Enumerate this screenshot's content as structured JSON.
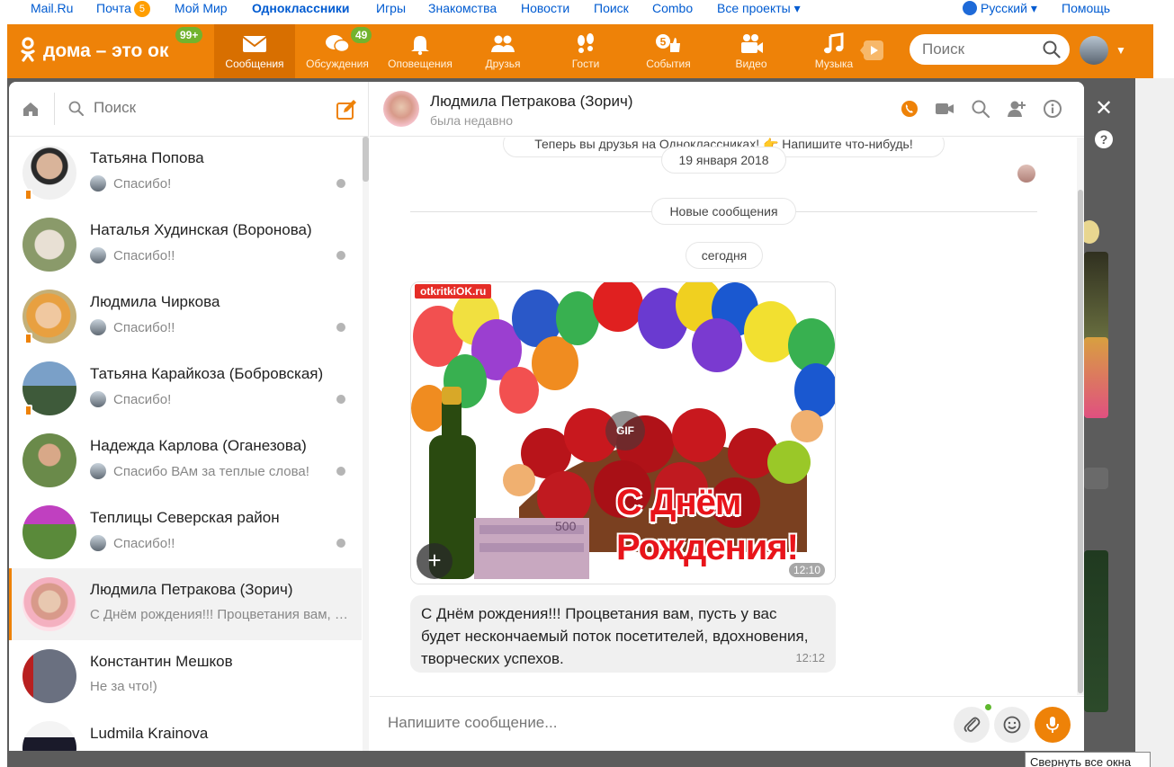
{
  "mailbar": {
    "links": [
      "Mail.Ru",
      "Почта",
      "Мой Мир",
      "Одноклассники",
      "Игры",
      "Знакомства",
      "Новости",
      "Поиск",
      "Combo",
      "Все проекты ▾"
    ],
    "mail_count": "5",
    "language": "Русский ▾",
    "help": "Помощь"
  },
  "header": {
    "logo": "дома – это ок",
    "logo_badge": "99+",
    "nav": [
      {
        "label": "Сообщения",
        "icon": "envelope-icon",
        "active": true
      },
      {
        "label": "Обсуждения",
        "icon": "chat-bubbles-icon",
        "badge": "49"
      },
      {
        "label": "Оповещения",
        "icon": "bell-icon"
      },
      {
        "label": "Друзья",
        "icon": "friends-icon"
      },
      {
        "label": "Гости",
        "icon": "footprints-icon"
      },
      {
        "label": "События",
        "icon": "like-icon",
        "badge": "5"
      },
      {
        "label": "Видео",
        "icon": "video-camera-icon"
      },
      {
        "label": "Музыка",
        "icon": "music-note-icon"
      }
    ],
    "search_placeholder": "Поиск"
  },
  "sidebar": {
    "search_placeholder": "Поиск",
    "chats": [
      {
        "name": "Татьяна Попова",
        "preview": "Спасибо!",
        "mobile": true
      },
      {
        "name": "Наталья Худинская (Воронова)",
        "preview": "Спасибо!!",
        "mobile": false
      },
      {
        "name": "Людмила Чиркова",
        "preview": "Спасибо!!",
        "mobile": true
      },
      {
        "name": "Татьяна Карайкоза (Бобровская)",
        "preview": "Спасибо!",
        "mobile": true
      },
      {
        "name": "Надежда Карлова (Оганезова)",
        "preview": "Спасибо ВАм за теплые слова!",
        "mobile": false
      },
      {
        "name": "Теплицы Северская район",
        "preview": "Спасибо!!",
        "mobile": false
      },
      {
        "name": "Людмила Петракова (Зорич)",
        "preview": "С Днём рождения!!! Процветания вам, пусть у вас будет",
        "mobile": false,
        "active": true
      },
      {
        "name": "Константин Мешков",
        "preview": "Не за что!)",
        "mobile": false
      },
      {
        "name": "Ludmila Krainova",
        "preview": "",
        "mobile": false
      }
    ]
  },
  "conversation": {
    "name": "Людмила Петракова (Зорич)",
    "status": "была недавно",
    "system_message": "Теперь вы друзья на Одноклассниках! 👉 Напишите что-нибудь!",
    "date_old": "19 января 2018",
    "new_messages_label": "Новые сообщения",
    "date_today": "сегодня",
    "gif": {
      "site": "otkritkiOK.ru",
      "badge": "GIF",
      "greeting_line1": "С Днём",
      "greeting_line2": "Рождения!",
      "time": "12:10",
      "banknote": "500"
    },
    "message": {
      "lines": [
        "С Днём рождения!!! Процветания вам, пусть у вас",
        "будет нескончаемый поток посетителей, вдохновения,",
        "творческих успехов."
      ],
      "time": "12:12"
    },
    "composer_placeholder": "Напишите сообщение..."
  },
  "overlay": {
    "close": "✕",
    "help": "?",
    "tooltip": "Свернуть все окна"
  },
  "colors": {
    "accent": "#ee8208",
    "badge_green": "#72b32d",
    "link_blue": "#005bd1"
  }
}
